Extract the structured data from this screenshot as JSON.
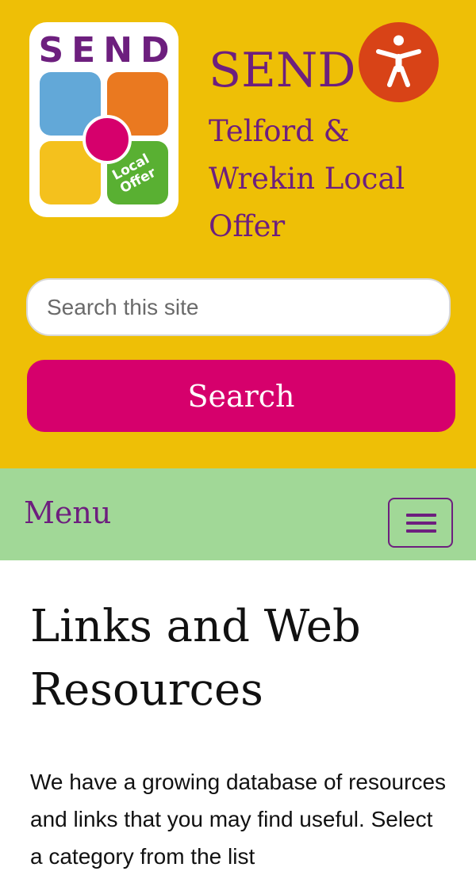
{
  "header": {
    "logo": {
      "word": "SEND",
      "badge_line1": "Local",
      "badge_line2": "Offer"
    },
    "title": "SEND",
    "subtitle": "Telford & Wrekin Local Offer",
    "accessibility_icon": "accessibility-person-icon"
  },
  "search": {
    "placeholder": "Search this site",
    "value": "",
    "button_label": "Search"
  },
  "nav": {
    "menu_label": "Menu",
    "toggle_icon": "hamburger-icon"
  },
  "main": {
    "heading": "Links and Web Resources",
    "intro": "We have a growing database of resources and links that you may find useful. Select a category from the list"
  },
  "colors": {
    "header_bg": "#eebf06",
    "brand_purple": "#6d1f7e",
    "search_button": "#d6006c",
    "accessibility_button": "#d84317",
    "nav_bg": "#a1d897"
  }
}
